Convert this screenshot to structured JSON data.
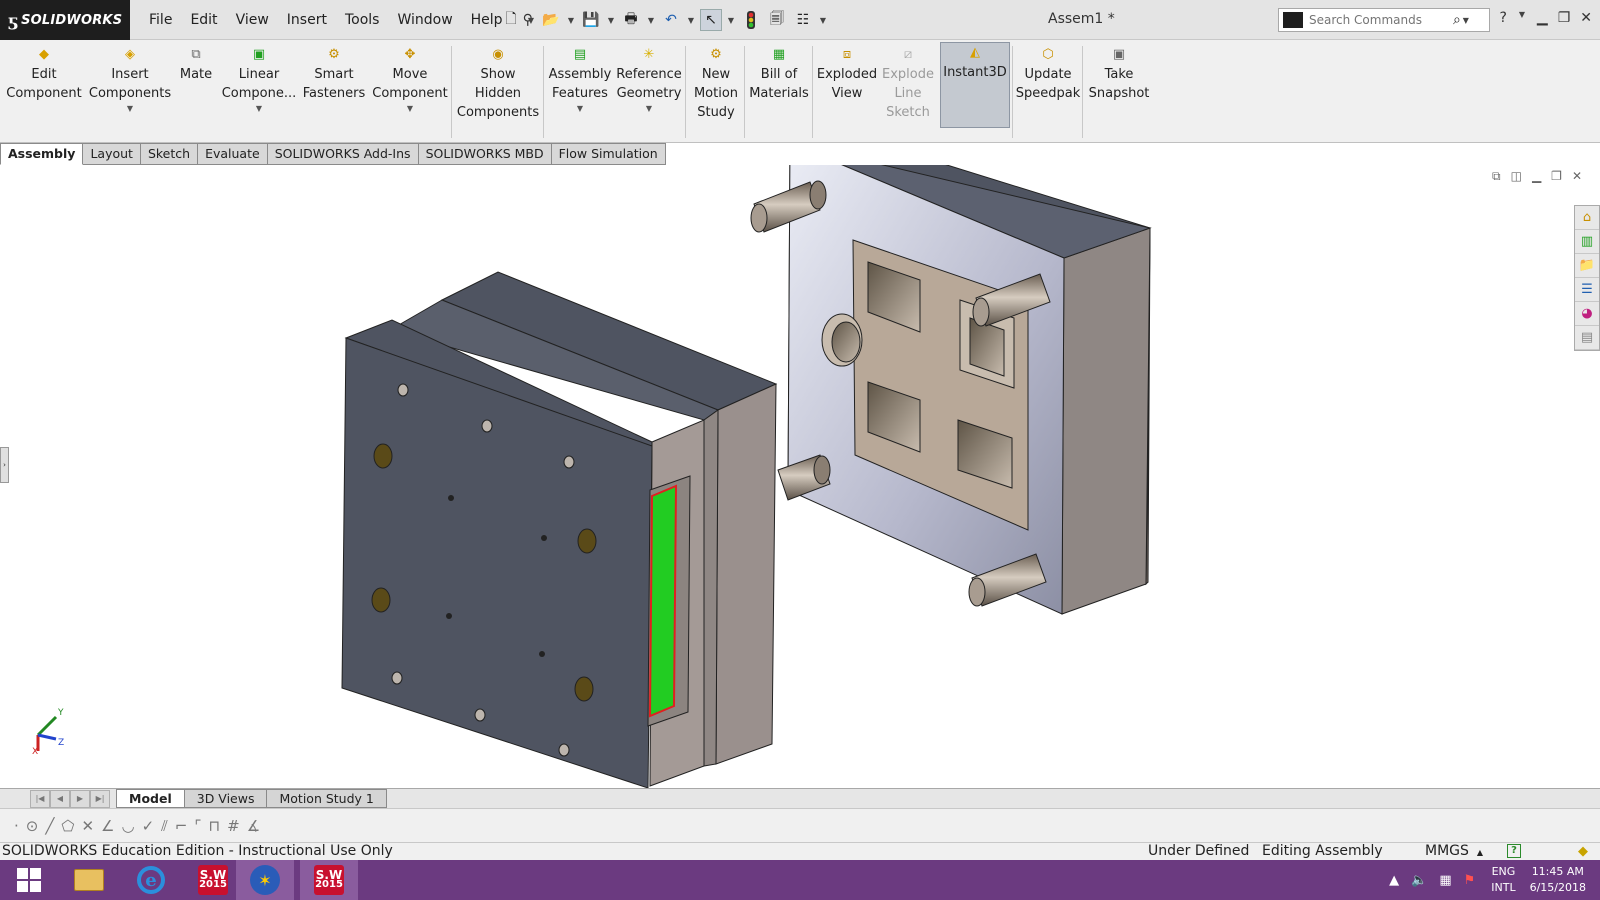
{
  "app": {
    "ds": "ƽ",
    "brand": "SOLIDWORKS",
    "doc_title": "Assem1 *"
  },
  "menu": [
    "File",
    "Edit",
    "View",
    "Insert",
    "Tools",
    "Window",
    "Help"
  ],
  "search": {
    "placeholder": "Search Commands"
  },
  "commands": [
    {
      "label": "Edit\nComponent",
      "icon": "edit-component-icon"
    },
    {
      "label": "Insert\nComponents",
      "icon": "insert-components-icon"
    },
    {
      "label": "Mate",
      "icon": "mate-icon"
    },
    {
      "label": "Linear\nCompone...",
      "icon": "linear-pattern-icon"
    },
    {
      "label": "Smart\nFasteners",
      "icon": "smart-fasteners-icon"
    },
    {
      "label": "Move\nComponent",
      "icon": "move-component-icon"
    },
    {
      "label": "Show\nHidden\nComponents",
      "icon": "show-hidden-icon"
    },
    {
      "label": "Assembly\nFeatures",
      "icon": "assembly-features-icon"
    },
    {
      "label": "Reference\nGeometry",
      "icon": "reference-geometry-icon"
    },
    {
      "label": "New\nMotion\nStudy",
      "icon": "motion-study-icon"
    },
    {
      "label": "Bill of\nMaterials",
      "icon": "bom-icon"
    },
    {
      "label": "Exploded\nView",
      "icon": "exploded-view-icon"
    },
    {
      "label": "Explode\nLine\nSketch",
      "icon": "explode-line-icon"
    },
    {
      "label": "Instant3D",
      "icon": "instant3d-icon"
    },
    {
      "label": "Update\nSpeedpak",
      "icon": "speedpak-icon"
    },
    {
      "label": "Take\nSnapshot",
      "icon": "snapshot-icon"
    }
  ],
  "tabs": [
    "Assembly",
    "Layout",
    "Sketch",
    "Evaluate",
    "SOLIDWORKS Add-Ins",
    "SOLIDWORKS MBD",
    "Flow Simulation"
  ],
  "bottom_tabs": [
    "Model",
    "3D Views",
    "Motion Study 1"
  ],
  "triad": {
    "y": "Y",
    "z": "Z",
    "x": "X"
  },
  "status": {
    "edition": "SOLIDWORKS Education Edition - Instructional Use Only",
    "defined": "Under Defined",
    "mode": "Editing Assembly",
    "units": "MMGS"
  },
  "taskbar": {
    "sw_label": "S.W",
    "sw_year": "2015",
    "lang": "ENG",
    "region": "INTL",
    "time": "11:45 AM",
    "date": "6/15/2018"
  },
  "colors": {
    "taskbar": "#6b3a80",
    "highlight_green": "#22cc22",
    "mold_dark": "#4f5461"
  }
}
